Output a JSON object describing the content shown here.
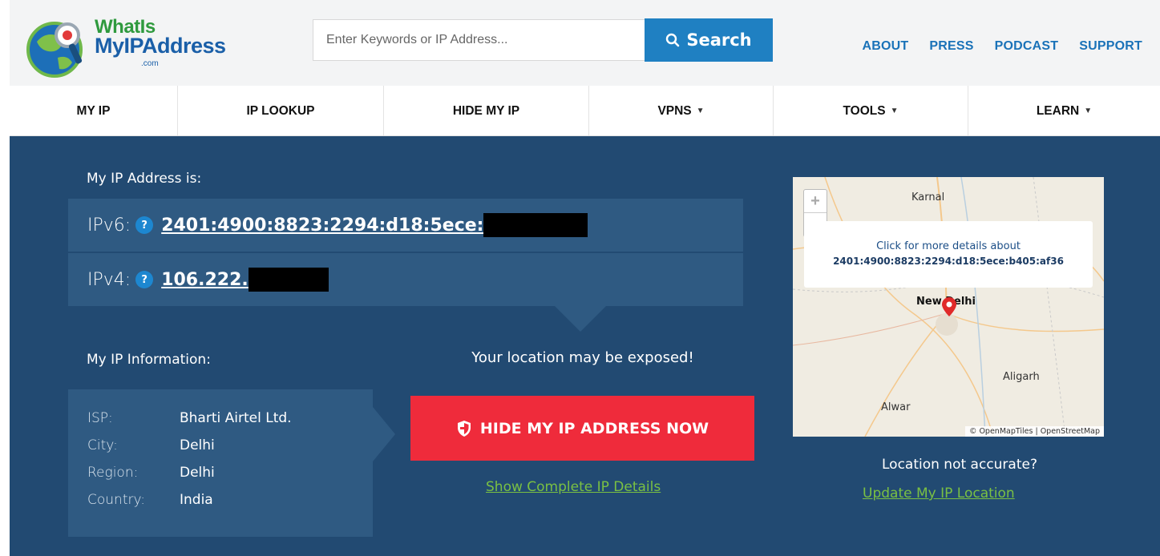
{
  "brand": {
    "line1": "WhatIs",
    "line2": "MyIPAddress",
    "suffix": ".com"
  },
  "search": {
    "placeholder": "Enter Keywords or IP Address...",
    "button_label": "Search"
  },
  "topnav": [
    "ABOUT",
    "PRESS",
    "PODCAST",
    "SUPPORT"
  ],
  "menu": [
    {
      "label": "MY IP",
      "caret": ""
    },
    {
      "label": "IP LOOKUP",
      "caret": ""
    },
    {
      "label": "HIDE MY IP",
      "caret": ""
    },
    {
      "label": "VPNS",
      "caret": "▼"
    },
    {
      "label": "TOOLS",
      "caret": "▼"
    },
    {
      "label": "LEARN",
      "caret": "▼"
    }
  ],
  "ip": {
    "heading": "My IP Address is:",
    "ipv6_label": "IPv6:",
    "ipv6_value": "2401:4900:8823:2294:d18:5ece:",
    "ipv4_label": "IPv4:",
    "ipv4_value": "106.222.",
    "help": "?"
  },
  "info": {
    "heading": "My IP Information:",
    "rows": [
      {
        "key": "ISP:",
        "value": "Bharti Airtel Ltd."
      },
      {
        "key": "City:",
        "value": "Delhi"
      },
      {
        "key": "Region:",
        "value": "Delhi"
      },
      {
        "key": "Country:",
        "value": "India"
      }
    ]
  },
  "cta": {
    "exposed_text": "Your location may be exposed!",
    "hide_button": "HIDE MY IP ADDRESS NOW",
    "details_link": "Show Complete IP Details"
  },
  "map": {
    "popup_line1": "Click for more details about",
    "popup_line2": "2401:4900:8823:2294:d18:5ece:b405:af36",
    "labels": [
      "Karnal",
      "New Delhi",
      "Aligarh",
      "Alwar"
    ],
    "attribution": "© OpenMapTiles | OpenStreetMap",
    "zoom_in": "+",
    "zoom_out": "−"
  },
  "location": {
    "question": "Location not accurate?",
    "update_link": "Update My IP Location"
  },
  "colors": {
    "primary_blue": "#224a72",
    "panel_blue": "#2f5a82",
    "search_blue": "#1f80c2",
    "cta_red": "#ef2b3b",
    "link_green": "#7ac043"
  }
}
